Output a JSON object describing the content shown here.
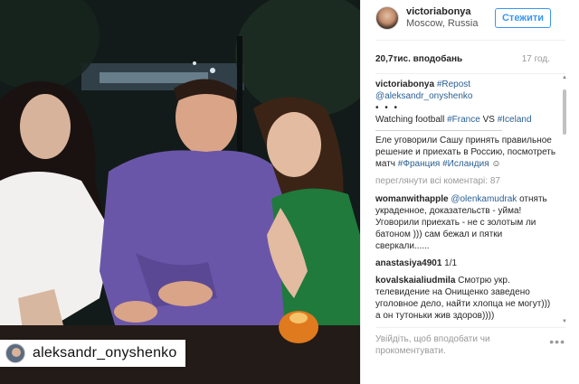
{
  "photo": {
    "tag_username": "aleksandr_onyshenko",
    "tag_avatar_icon": "avatar-icon"
  },
  "header": {
    "username": "victoriabonya",
    "location": "Moscow, Russia",
    "follow_label": "Стежити"
  },
  "stats": {
    "likes": "20,7тис. вподобань",
    "time_ago": "17 год."
  },
  "caption": {
    "username": "victoriabonya",
    "repost": "#Repost",
    "mention": "@aleksandr_onyshenko",
    "dots": "• • •",
    "line1_text": "Watching football ",
    "tag1": "#France",
    "vs": " VS ",
    "tag2": "#Iceland",
    "ru_text": "Еле уговорили Сашу принять правильное решение и приехать в Россию, посмотреть матч ",
    "ru_tag1": "#Франция",
    "ru_tag2": "#Исландия",
    "ru_emoji": " ☺"
  },
  "view_all": "переглянути всі коментарі: 87",
  "comments": [
    {
      "user": "womanwithapple",
      "mention": "@olenkamudrak",
      "text": " отнять украденное, доказательств - уйма! Уговорили приехать - не с золотым ли батоном ))) сам бежал и пятки сверкали......"
    },
    {
      "user": "anastasiya4901",
      "text": " 1/1"
    },
    {
      "user": "kovalskaialiudmila",
      "text": " Смотрю укр. телевидение на Онищенко заведено уголовное дело, найти хлопца не могут))) а он тутоньки жив здоров))))"
    }
  ],
  "footer": {
    "add_comment": "Увійдіть, щоб вподобати чи прокоментувати.",
    "more_icon": "more-icon"
  },
  "colors": {
    "accent": "#3897f0",
    "link": "#2a5f92",
    "muted": "#999999"
  }
}
